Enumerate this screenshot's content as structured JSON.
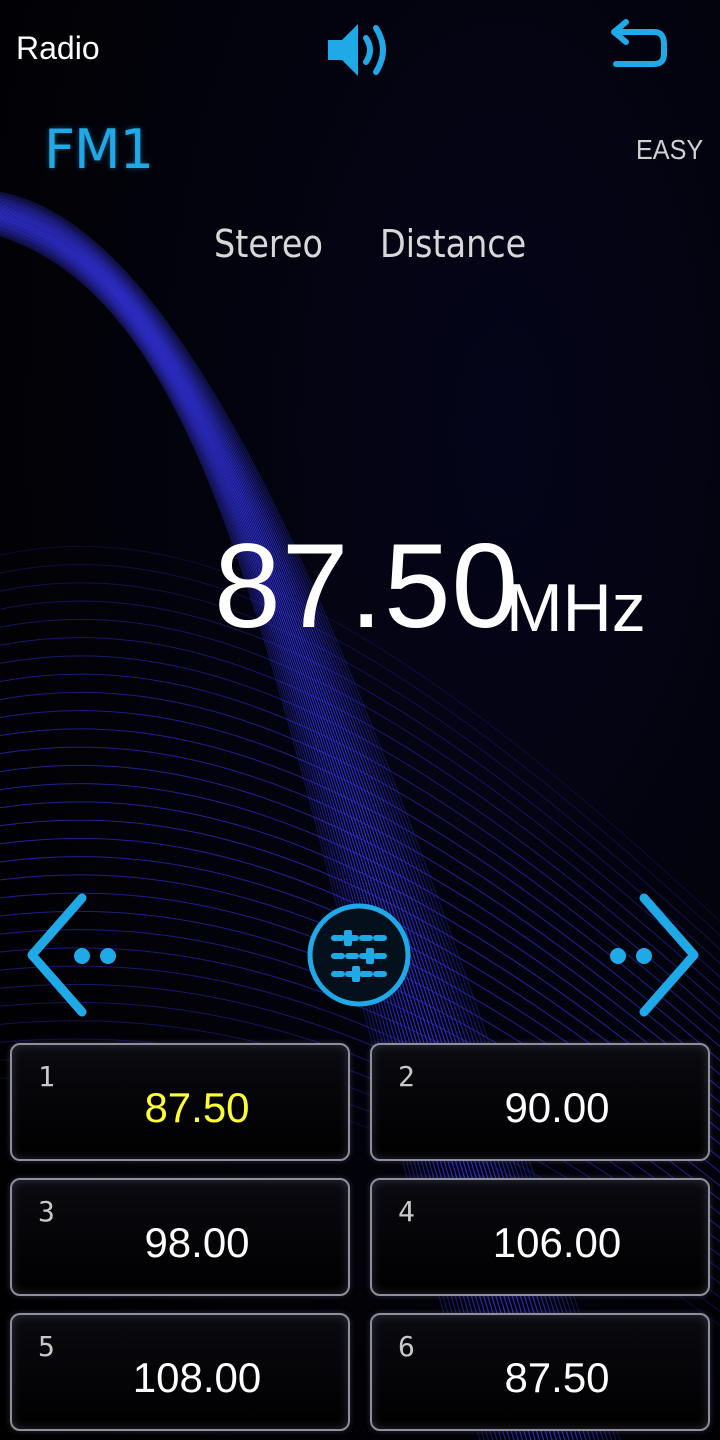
{
  "header": {
    "title": "Radio",
    "volume_icon": "volume-icon",
    "back_icon": "back-icon"
  },
  "tuner": {
    "band": "FM1",
    "mode": "EASY",
    "stereo": "Stereo",
    "distance": "Distance",
    "frequency": "87.50",
    "unit": "MHz"
  },
  "controls": {
    "prev_icon": "chevron-left-icon",
    "next_icon": "chevron-right-icon",
    "settings_icon": "sliders-icon"
  },
  "presets": [
    {
      "number": "1",
      "frequency": "87.50",
      "active": true
    },
    {
      "number": "2",
      "frequency": "90.00",
      "active": false
    },
    {
      "number": "3",
      "frequency": "98.00",
      "active": false
    },
    {
      "number": "4",
      "frequency": "106.00",
      "active": false
    },
    {
      "number": "5",
      "frequency": "108.00",
      "active": false
    },
    {
      "number": "6",
      "frequency": "87.50",
      "active": false
    }
  ],
  "colors": {
    "accent": "#1fa9e6",
    "active_preset": "#ffff33",
    "wave": "#3a3aff"
  }
}
